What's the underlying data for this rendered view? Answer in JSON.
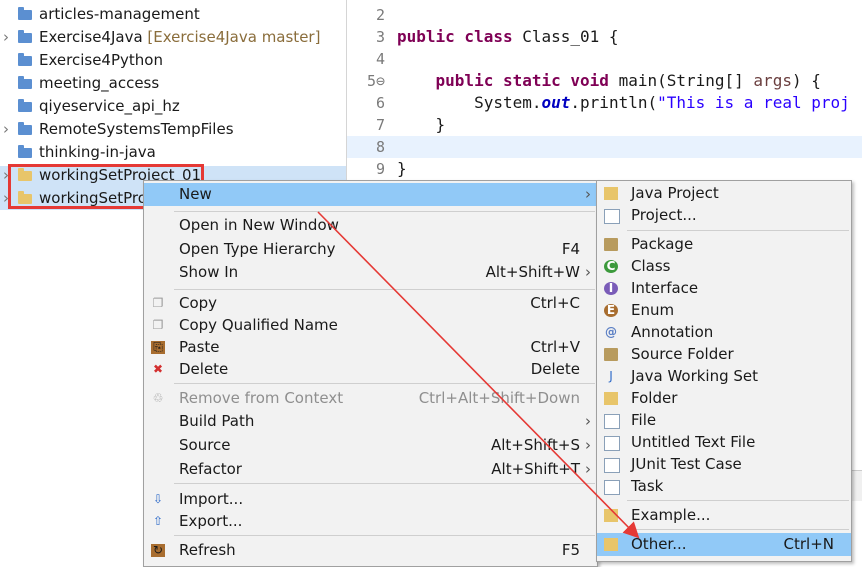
{
  "explorer": {
    "items": [
      {
        "label": "articles-management",
        "deco": "",
        "twisty": false
      },
      {
        "label": "Exercise4Java",
        "deco": "[Exercise4Java master]",
        "twisty": true
      },
      {
        "label": "Exercise4Python",
        "deco": "",
        "twisty": false
      },
      {
        "label": "meeting_access",
        "deco": "",
        "twisty": false
      },
      {
        "label": "qiyeservice_api_hz",
        "deco": "",
        "twisty": false
      },
      {
        "label": "RemoteSystemsTempFiles",
        "deco": "",
        "twisty": true
      },
      {
        "label": "thinking-in-java",
        "deco": "",
        "twisty": false
      },
      {
        "label": "workingSetProject_01",
        "deco": "",
        "twisty": true
      },
      {
        "label": "workingSetPro",
        "deco": "",
        "twisty": true
      }
    ]
  },
  "editor": {
    "lines": [
      {
        "n": "2",
        "parts": []
      },
      {
        "n": "3",
        "parts": [
          {
            "t": "public class ",
            "c": "kw"
          },
          {
            "t": "Class_01 {",
            "c": ""
          }
        ]
      },
      {
        "n": "4",
        "parts": []
      },
      {
        "n": "5⊖",
        "parts": [
          {
            "t": "    public static void ",
            "c": "kw"
          },
          {
            "t": "main(String[] ",
            "c": ""
          },
          {
            "t": "args",
            "c": "param"
          },
          {
            "t": ") {",
            "c": ""
          }
        ]
      },
      {
        "n": "6",
        "parts": [
          {
            "t": "        System.",
            "c": ""
          },
          {
            "t": "out",
            "c": "field"
          },
          {
            "t": ".println(",
            "c": ""
          },
          {
            "t": "\"This is a real proj",
            "c": "str"
          }
        ]
      },
      {
        "n": "7",
        "parts": [
          {
            "t": "    }",
            "c": ""
          }
        ]
      },
      {
        "n": "8",
        "parts": []
      },
      {
        "n": "9",
        "parts": [
          {
            "t": "}",
            "c": ""
          }
        ]
      }
    ]
  },
  "context_menu": {
    "items": [
      {
        "label": "New",
        "accel": "",
        "submenu": true,
        "icon": "",
        "active": true
      },
      {
        "sep": true
      },
      {
        "label": "Open in New Window",
        "accel": "",
        "icon": ""
      },
      {
        "label": "Open Type Hierarchy",
        "accel": "F4",
        "icon": ""
      },
      {
        "label": "Show In",
        "accel": "Alt+Shift+W",
        "submenu": true,
        "icon": ""
      },
      {
        "sep": true
      },
      {
        "label": "Copy",
        "accel": "Ctrl+C",
        "icon": "copy-icon"
      },
      {
        "label": "Copy Qualified Name",
        "accel": "",
        "icon": "copy-qualified-icon"
      },
      {
        "label": "Paste",
        "accel": "Ctrl+V",
        "icon": "paste-icon"
      },
      {
        "label": "Delete",
        "accel": "Delete",
        "icon": "delete-icon"
      },
      {
        "sep": true
      },
      {
        "label": "Remove from Context",
        "accel": "Ctrl+Alt+Shift+Down",
        "icon": "remove-context-icon",
        "disabled": true
      },
      {
        "label": "Build Path",
        "accel": "",
        "submenu": true,
        "icon": ""
      },
      {
        "label": "Source",
        "accel": "Alt+Shift+S",
        "submenu": true,
        "icon": ""
      },
      {
        "label": "Refactor",
        "accel": "Alt+Shift+T",
        "submenu": true,
        "icon": ""
      },
      {
        "sep": true
      },
      {
        "label": "Import...",
        "accel": "",
        "icon": "import-icon"
      },
      {
        "label": "Export...",
        "accel": "",
        "icon": "export-icon"
      },
      {
        "sep": true
      },
      {
        "label": "Refresh",
        "accel": "F5",
        "icon": "refresh-icon"
      }
    ]
  },
  "new_submenu": {
    "items": [
      {
        "label": "Java Project",
        "accel": "",
        "icon": "java-project-icon"
      },
      {
        "label": "Project...",
        "accel": "",
        "icon": "project-icon"
      },
      {
        "sep": true
      },
      {
        "label": "Package",
        "accel": "",
        "icon": "package-icon"
      },
      {
        "label": "Class",
        "accel": "",
        "icon": "class-icon"
      },
      {
        "label": "Interface",
        "accel": "",
        "icon": "interface-icon"
      },
      {
        "label": "Enum",
        "accel": "",
        "icon": "enum-icon"
      },
      {
        "label": "Annotation",
        "accel": "",
        "icon": "annotation-icon"
      },
      {
        "label": "Source Folder",
        "accel": "",
        "icon": "source-folder-icon"
      },
      {
        "label": "Java Working Set",
        "accel": "",
        "icon": "working-set-icon"
      },
      {
        "label": "Folder",
        "accel": "",
        "icon": "folder-icon"
      },
      {
        "label": "File",
        "accel": "",
        "icon": "file-icon"
      },
      {
        "label": "Untitled Text File",
        "accel": "",
        "icon": "text-file-icon"
      },
      {
        "label": "JUnit Test Case",
        "accel": "",
        "icon": "junit-icon"
      },
      {
        "label": "Task",
        "accel": "",
        "icon": "task-icon"
      },
      {
        "sep": true
      },
      {
        "label": "Example...",
        "accel": "",
        "icon": "example-icon"
      },
      {
        "sep": true
      },
      {
        "label": "Other...",
        "accel": "Ctrl+N",
        "icon": "other-icon",
        "active": true
      }
    ]
  },
  "colors": {
    "highlight_box": "#e53935",
    "annotation_arrow": "#e53935",
    "menu_active": "#91c9f7"
  }
}
